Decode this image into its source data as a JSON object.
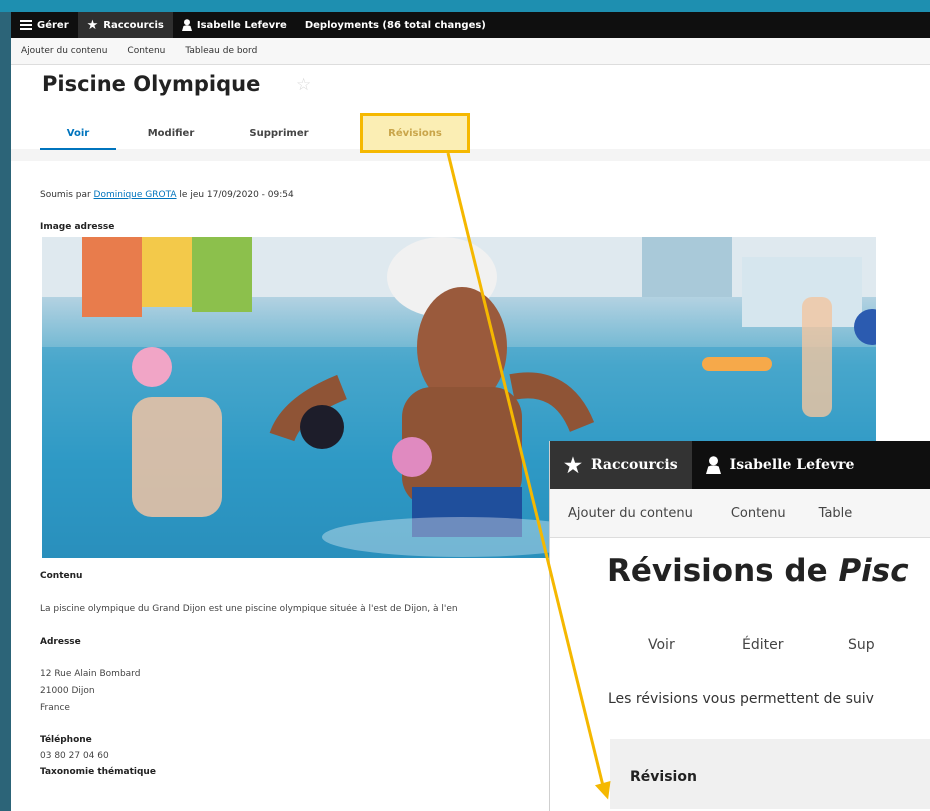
{
  "colors": {
    "accent": "#f5b800",
    "link": "#0074bd",
    "toolbar": "#0f0f0f"
  },
  "back_window": {
    "toolbar": {
      "manage": "Gérer",
      "shortcuts": "Raccourcis",
      "user": "Isabelle Lefevre",
      "deployments": "Deployments (86 total changes)"
    },
    "shortcuts_bar": [
      "Ajouter du contenu",
      "Contenu",
      "Tableau de bord"
    ],
    "title": "Piscine Olympique",
    "tabs": [
      {
        "label": "Voir",
        "active": true
      },
      {
        "label": "Modifier"
      },
      {
        "label": "Supprimer"
      },
      {
        "label": "Révisions",
        "highlighted": true
      }
    ],
    "submitted": {
      "prefix": "Soumis par",
      "author": "Dominique GROTA",
      "suffix": "le jeu 17/09/2020 - 09:54"
    },
    "image_label": "Image adresse",
    "content_label": "Contenu",
    "content_text": "La piscine olympique du Grand Dijon est une piscine olympique située à l'est de Dijon, à l'en",
    "address_label": "Adresse",
    "address_lines": [
      "12 Rue Alain Bombard",
      "21000 Dijon",
      "France"
    ],
    "phone_label": "Téléphone",
    "phone": "03 80 27 04 60",
    "taxonomy_label": "Taxonomie thématique"
  },
  "front_window": {
    "toolbar": {
      "shortcuts": "Raccourcis",
      "user": "Isabelle Lefevre"
    },
    "shortcuts_bar": [
      "Ajouter du contenu",
      "Contenu",
      "Table"
    ],
    "title_prefix": "Révisions de",
    "title_italic": "Pisc",
    "tabs": [
      "Voir",
      "Éditer",
      "Sup"
    ],
    "description": "Les révisions vous permettent de suiv",
    "revision_header": "Révision"
  },
  "icons": [
    "hamburger-icon",
    "star-icon",
    "user-icon"
  ]
}
